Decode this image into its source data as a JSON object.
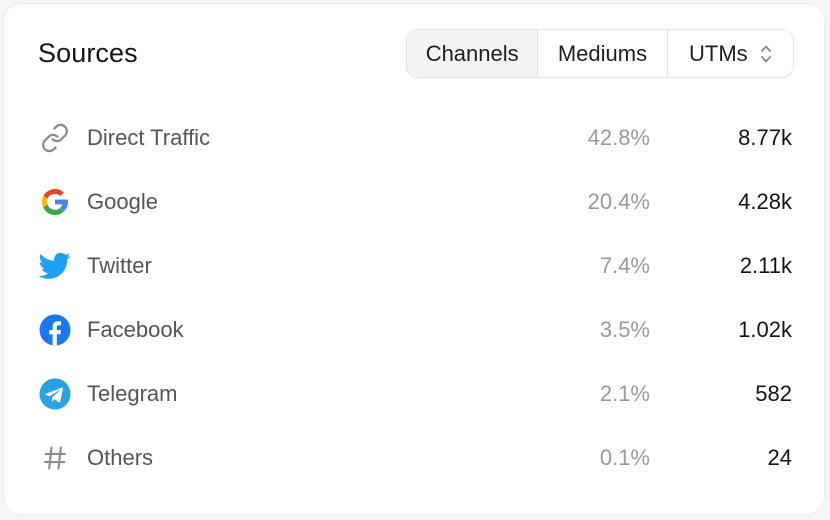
{
  "card": {
    "title": "Sources",
    "tabs": [
      {
        "label": "Channels",
        "active": true
      },
      {
        "label": "Mediums",
        "active": false
      },
      {
        "label": "UTMs",
        "active": false,
        "icon": "up-down-chevron-icon"
      }
    ]
  },
  "sources": [
    {
      "name": "Direct Traffic",
      "icon": "link-icon",
      "percent": "42.8%",
      "count": "8.77k"
    },
    {
      "name": "Google",
      "icon": "google-icon",
      "percent": "20.4%",
      "count": "4.28k"
    },
    {
      "name": "Twitter",
      "icon": "twitter-icon",
      "percent": "7.4%",
      "count": "2.11k"
    },
    {
      "name": "Facebook",
      "icon": "facebook-icon",
      "percent": "3.5%",
      "count": "1.02k"
    },
    {
      "name": "Telegram",
      "icon": "telegram-icon",
      "percent": "2.1%",
      "count": "582"
    },
    {
      "name": "Others",
      "icon": "hash-icon",
      "percent": "0.1%",
      "count": "24"
    }
  ],
  "colors": {
    "google_blue": "#4285F4",
    "google_red": "#EA4335",
    "google_yellow": "#FBBC05",
    "google_green": "#34A853",
    "twitter": "#1DA1F2",
    "facebook": "#1877F2",
    "telegram": "#27A3E1",
    "muted_icon": "#8a8a8e"
  }
}
